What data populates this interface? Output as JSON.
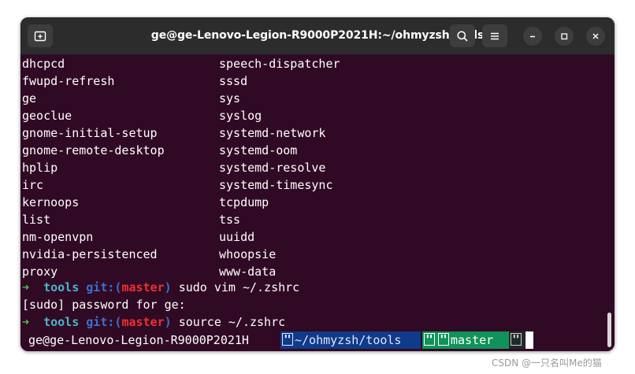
{
  "window": {
    "title": "ge@ge-Lenovo-Legion-R9000P2021H:~/ohmyzsh/tools",
    "icons": [
      "new-tab-icon",
      "search-icon",
      "hamburger-menu-icon",
      "minimize-icon",
      "maximize-icon",
      "close-icon"
    ]
  },
  "listing": [
    {
      "left": "dhcpcd",
      "right": "speech-dispatcher"
    },
    {
      "left": "fwupd-refresh",
      "right": "sssd"
    },
    {
      "left": "ge",
      "right": "sys"
    },
    {
      "left": "geoclue",
      "right": "syslog"
    },
    {
      "left": "gnome-initial-setup",
      "right": "systemd-network"
    },
    {
      "left": "gnome-remote-desktop",
      "right": "systemd-oom"
    },
    {
      "left": "hplip",
      "right": "systemd-resolve"
    },
    {
      "left": "irc",
      "right": "systemd-timesync"
    },
    {
      "left": "kernoops",
      "right": "tcpdump"
    },
    {
      "left": "list",
      "right": "tss"
    },
    {
      "left": "nm-openvpn",
      "right": "uuidd"
    },
    {
      "left": "nvidia-persistenced",
      "right": "whoopsie"
    },
    {
      "left": "proxy",
      "right": "www-data"
    }
  ],
  "prompt1": {
    "arrow": "➜",
    "dir": "tools",
    "git_label": "git:",
    "paren_open": "(",
    "branch": "master",
    "paren_close": ")",
    "command": "sudo vim ~/.zshrc"
  },
  "sudo_line": "[sudo] password for ge:",
  "prompt2": {
    "arrow": "➜",
    "dir": "tools",
    "git_label": "git:",
    "paren_open": "(",
    "branch": "master",
    "paren_close": ")",
    "command": "source ~/.zshrc"
  },
  "statusline": {
    "host": "ge@ge-Lenovo-Legion-R9000P2021H",
    "path": "~/ohmyzsh/tools",
    "branch": "master",
    "colors": {
      "path_bg": "#103a8a",
      "git_bg": "#11925a"
    }
  },
  "watermark": "CSDN @一只名叫Me的猫",
  "colors": {
    "terminal_bg": "#300a24",
    "titlebar_bg": "#2c2c2c",
    "prompt_arrow": "#4ec24e",
    "prompt_dir": "#4cb4c8",
    "git": "#3b6fd0",
    "branch": "#ef3030"
  }
}
